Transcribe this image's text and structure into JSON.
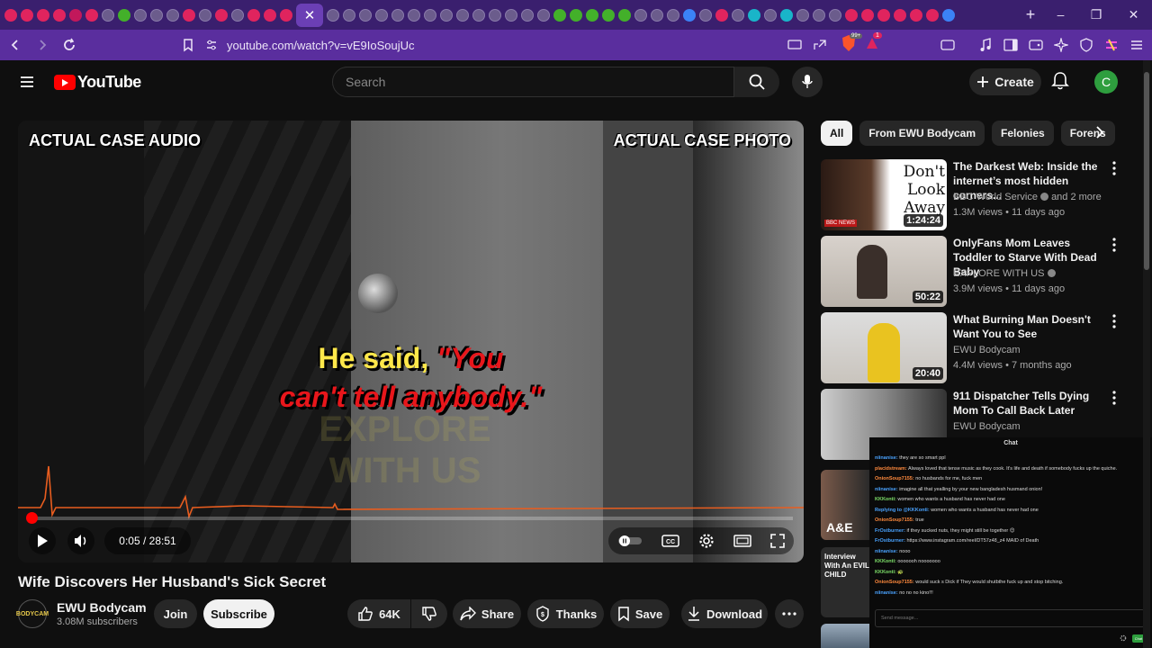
{
  "browser": {
    "url": "youtube.com/watch?v=vE9IoSoujUc",
    "new_tab": "+",
    "window_controls": [
      "–",
      "❐",
      "✕"
    ],
    "shield_badge": "99+",
    "alert_badge": "1"
  },
  "header": {
    "logo_text": "YouTube",
    "search_placeholder": "Search",
    "create_label": "Create",
    "avatar_letter": "C"
  },
  "video": {
    "overlay_left": "ACTUAL CASE AUDIO",
    "overlay_right": "ACTUAL CASE PHOTO",
    "caption_line1_plain": "He said, ",
    "caption_line1_quote": "\"You",
    "caption_line2": "can't tell anybody.\"",
    "watermark": "EXPLORE WITH US",
    "time": "0:05 / 28:51",
    "progress": 0.003,
    "title": "Wife Discovers Her Husband's Sick Secret"
  },
  "channel": {
    "avatar_text": "BODYCAM",
    "name": "EWU Bodycam",
    "subscribers": "3.08M subscribers",
    "join_label": "Join",
    "subscribe_label": "Subscribe",
    "likes": "64K",
    "share_label": "Share",
    "thanks_label": "Thanks",
    "save_label": "Save",
    "download_label": "Download"
  },
  "chips": [
    "All",
    "From EWU Bodycam",
    "Felonies",
    "Forens"
  ],
  "recommendations": [
    {
      "title": "The Darkest Web: Inside the internet’s most hidden corners...",
      "channel": "BBC World Service",
      "extra": "and 2 more",
      "meta": "1.3M views • 11 days ago",
      "duration": "1:24:24",
      "thumb_text": "Don't Look Away",
      "thumb_badge": "BBC NEWS",
      "verified": true
    },
    {
      "title": "OnlyFans Mom Leaves Toddler to Starve With Dead Baby",
      "channel": "EXPLORE WITH US",
      "meta": "3.9M views • 11 days ago",
      "duration": "50:22",
      "verified": true
    },
    {
      "title": "What Burning Man Doesn't Want You to See",
      "channel": "EWU Bodycam",
      "meta": "4.4M views • 7 months ago",
      "duration": "20:40",
      "verified": false
    },
    {
      "title": "911 Dispatcher Tells Dying Mom To Call Back Later",
      "channel": "EWU Bodycam",
      "meta": "",
      "duration": "",
      "verified": false
    }
  ],
  "partial_thumbs": [
    "A&E",
    "Interview With An EVIL CHILD"
  ],
  "chat": {
    "header": "Chat",
    "lines": [
      {
        "user": "niinanise:",
        "text": " they are so smart ppl",
        "c": "u1"
      },
      {
        "user": "placidstream:",
        "text": " Always loved that tense music as they cook. It's life and death if somebody fucks up the quiche.",
        "c": "u2"
      },
      {
        "user": "OnionSoup7155:",
        "text": " no husbands for me, fuck men",
        "c": "u2"
      },
      {
        "user": "niinanise:",
        "text": " imagine all that yealling by your new bangladesh husmand onion!",
        "c": "u1"
      },
      {
        "user": "KKKonti:",
        "text": " women who wants a husband has never had one",
        "c": "u3"
      },
      {
        "user": "Replying to @KKKonti:",
        "text": " women who wants a husband has never had one",
        "c": "u1"
      },
      {
        "user": "OnionSoup7155:",
        "text": " true",
        "c": "u2"
      },
      {
        "user": "FrOstburner:",
        "text": " if they sucked nuts, they might still be together 😊",
        "c": "u1"
      },
      {
        "user": "FrOstburner:",
        "text": " https://www.instagram.com/reel/DT57z48_z4 MAID of Death",
        "c": "u1"
      },
      {
        "user": "niinanise:",
        "text": " nooo",
        "c": "u1"
      },
      {
        "user": "KKKonti:",
        "text": " ooooooh nooooooo",
        "c": "u3"
      },
      {
        "user": "KKKonti:",
        "text": " 🐢",
        "c": "u3"
      },
      {
        "user": "OnionSoup7155:",
        "text": " would suck s Dick if They would shutbthe fuck up and stop bitching.",
        "c": "u2"
      },
      {
        "user": "niinanise:",
        "text": " no no no kino!!!",
        "c": "u1"
      }
    ],
    "input_placeholder": "Send message...",
    "send_label": "Chat"
  }
}
